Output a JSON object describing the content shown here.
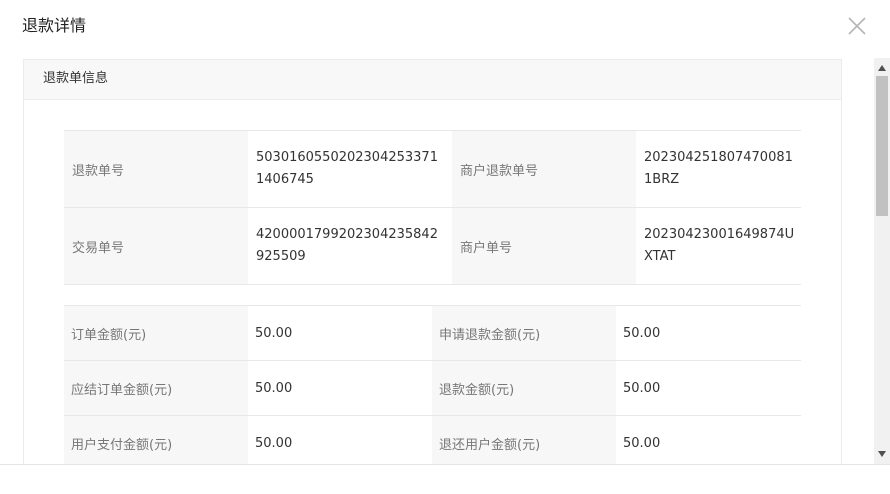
{
  "dialog": {
    "title": "退款详情",
    "close_icon": "close-icon"
  },
  "panel": {
    "header": "退款单信息"
  },
  "refund_info": [
    {
      "label1": "退款单号",
      "value1": "50301605502023042533711406745",
      "label2": "商户退款单号",
      "value2": "2023042518074700811BRZ"
    },
    {
      "label1": "交易单号",
      "value1": "4200001799202304235842925509",
      "label2": "商户单号",
      "value2": "20230423001649874UXTAT"
    }
  ],
  "amounts": [
    {
      "label1": "订单金额(元)",
      "value1": "50.00",
      "label2": "申请退款金额(元)",
      "value2": "50.00"
    },
    {
      "label1": "应结订单金额(元)",
      "value1": "50.00",
      "label2": "退款金额(元)",
      "value2": "50.00"
    },
    {
      "label1": "用户支付金额(元)",
      "value1": "50.00",
      "label2": "退还用户金额(元)",
      "value2": "50.00"
    }
  ]
}
